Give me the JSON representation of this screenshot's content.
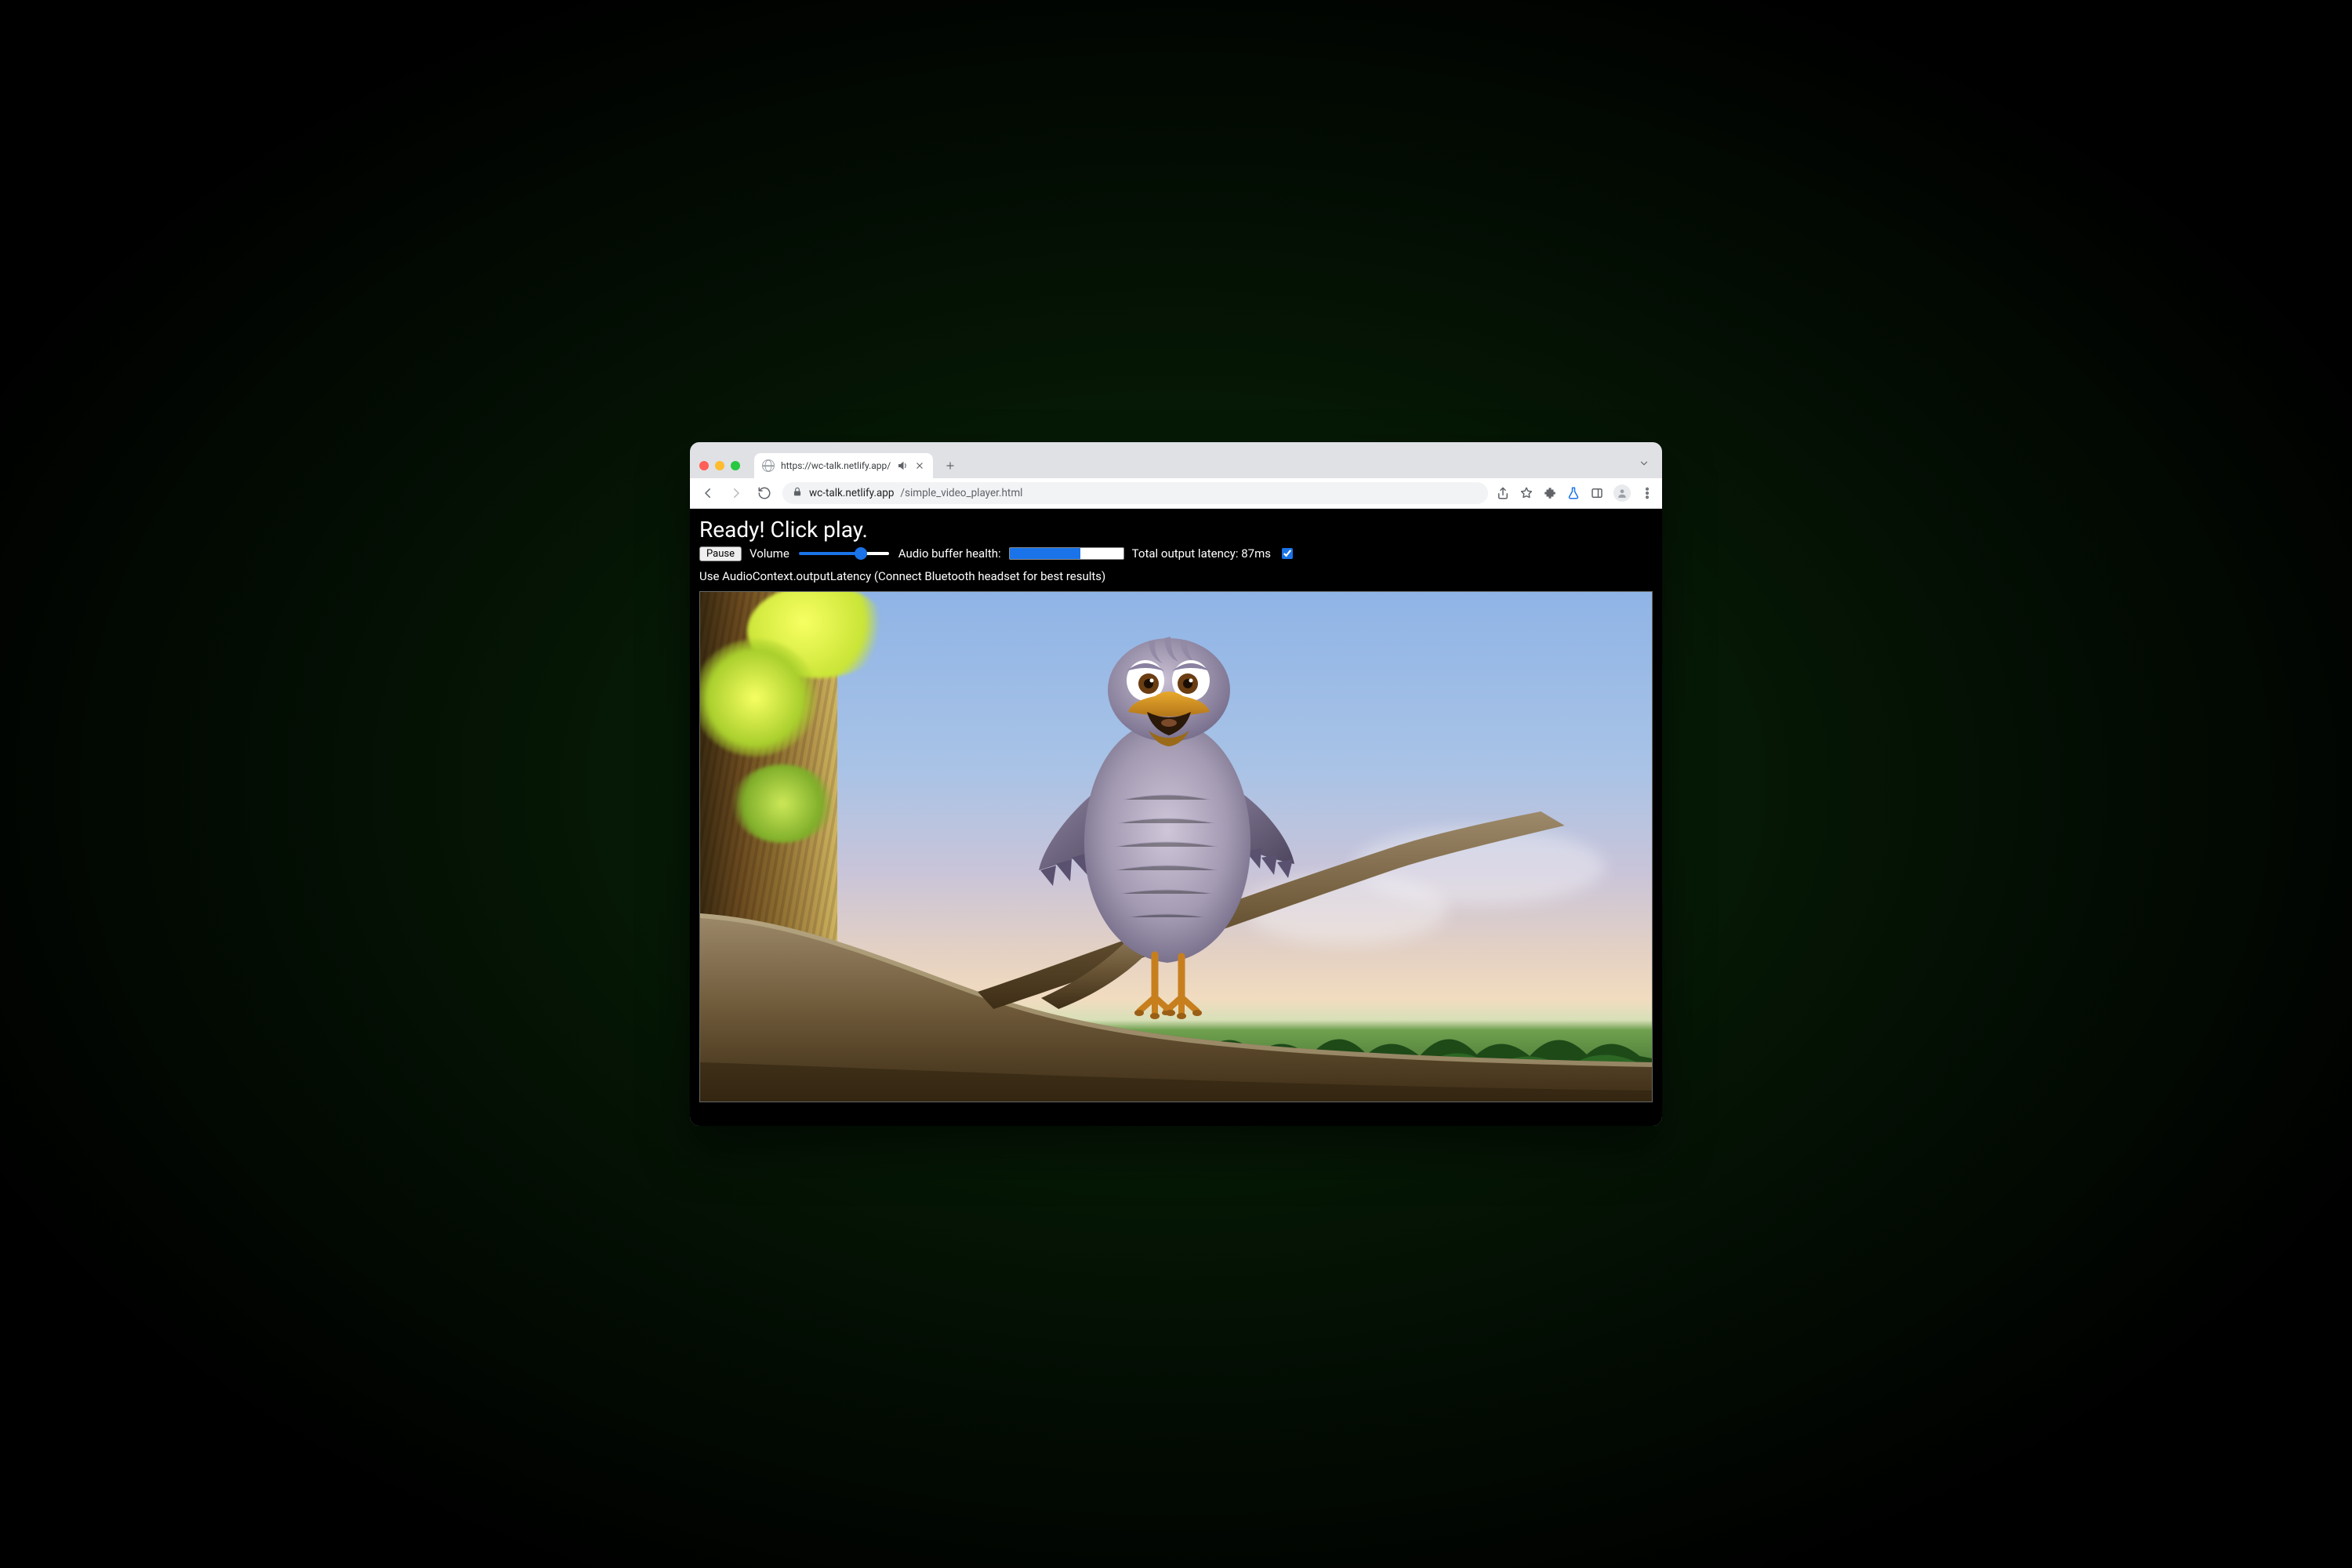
{
  "browser": {
    "tab_title": "https://wc-talk.netlify.app/",
    "url_host": "wc-talk.netlify.app",
    "url_path": "/simple_video_player.html"
  },
  "page": {
    "heading": "Ready! Click play.",
    "pause_label": "Pause",
    "volume_label": "Volume",
    "volume_value": 72,
    "buffer_label": "Audio buffer health:",
    "buffer_percent": 62,
    "latency_label": "Total output latency:",
    "latency_value": "87ms",
    "checkbox_checked": true,
    "checkbox_label": "Use AudioContext.outputLatency (Connect Bluetooth headset for best results)"
  }
}
